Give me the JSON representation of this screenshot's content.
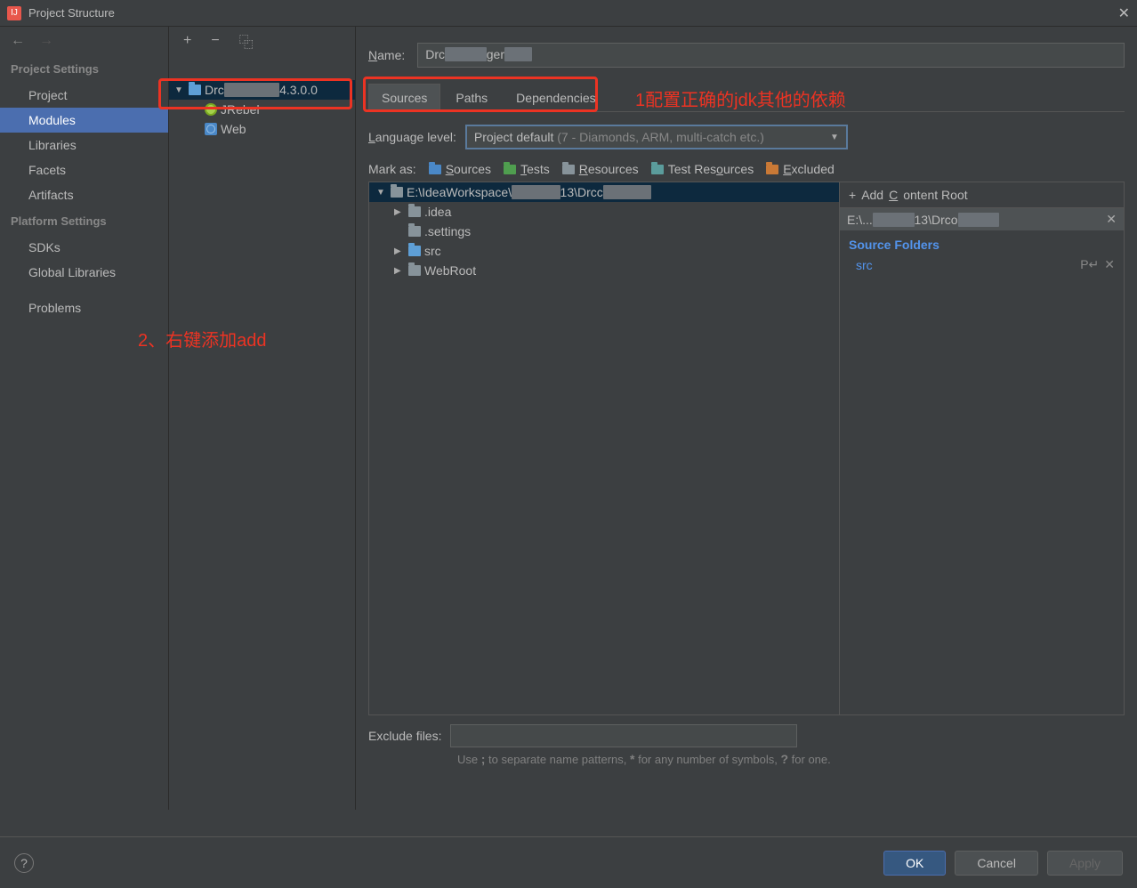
{
  "window": {
    "title": "Project Structure"
  },
  "sidebar": {
    "sections": [
      {
        "header": "Project Settings",
        "items": [
          "Project",
          "Modules",
          "Libraries",
          "Facets",
          "Artifacts"
        ],
        "selected": 1
      },
      {
        "header": "Platform Settings",
        "items": [
          "SDKs",
          "Global Libraries"
        ]
      },
      {
        "header": "",
        "items": [
          "Problems"
        ]
      }
    ]
  },
  "moduleTree": {
    "root": {
      "prefix": "Drc",
      "suffix": "4.3.0.0"
    },
    "children": [
      "JRebel",
      "Web"
    ]
  },
  "name": {
    "label": "Name:",
    "value_prefix": "Drc",
    "value_mid": "ger"
  },
  "tabs": [
    "Sources",
    "Paths",
    "Dependencies"
  ],
  "activeTab": 0,
  "annotation1": "1配置正确的jdk其他的依赖",
  "annotation2": "2、右键添加add",
  "languageLevel": {
    "label": "Language level:",
    "value_main": "Project default",
    "value_gray": " (7 - Diamonds, ARM, multi-catch etc.)"
  },
  "markAs": {
    "label": "Mark as:",
    "items": [
      {
        "label": "Sources",
        "color": "mf-blue",
        "u": "S"
      },
      {
        "label": "Tests",
        "color": "mf-green",
        "u": "T"
      },
      {
        "label": "Resources",
        "color": "mf-gray",
        "u": "R"
      },
      {
        "label": "Test Resources",
        "color": "mf-teal",
        "u": null
      },
      {
        "label": "Excluded",
        "color": "mf-orange",
        "u": "E"
      }
    ]
  },
  "sourceTree": {
    "root_prefix": "E:\\IdeaWorkspace\\",
    "root_mid": "13\\Drcc",
    "children": [
      {
        "name": ".idea",
        "expandable": false
      },
      {
        "name": ".settings",
        "expandable": false
      },
      {
        "name": "src",
        "expandable": true,
        "blue": true
      },
      {
        "name": "WebRoot",
        "expandable": true
      }
    ]
  },
  "contentRoot": {
    "addLabel": "Add Content Root",
    "path_prefix": "E:\\...",
    "path_mid": "13\\Drco",
    "sourceFoldersHeader": "Source Folders",
    "sourceFolders": [
      "src"
    ]
  },
  "exclude": {
    "label": "Exclude files:",
    "hint": "Use ; to separate name patterns, * for any number of symbols, ? for one."
  },
  "footer": {
    "ok": "OK",
    "cancel": "Cancel",
    "apply": "Apply"
  }
}
